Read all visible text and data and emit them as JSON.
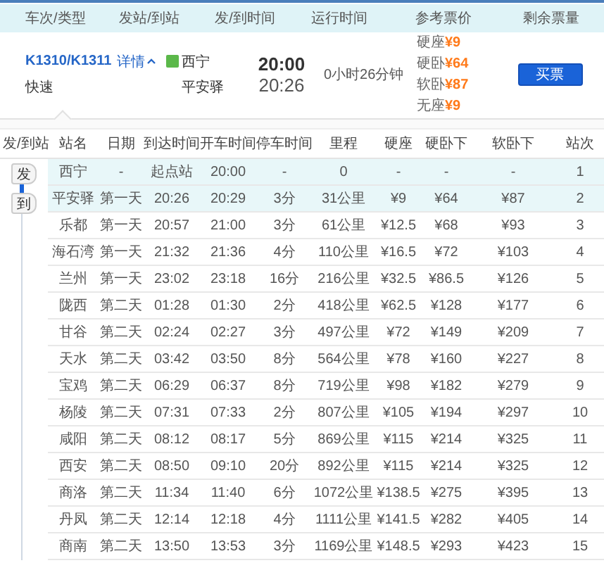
{
  "header": [
    "车次/类型",
    "发站/到站",
    "发/到时间",
    "运行时间",
    "参考票价",
    "剩余票量"
  ],
  "train": {
    "number": "K1310/K1311",
    "details_link": "详情",
    "expanded": true,
    "type": "快速",
    "from_station": "西宁",
    "to_station": "平安驿",
    "depart_time": "20:00",
    "arrive_time": "20:26",
    "duration": "0小时26分钟",
    "prices": [
      {
        "seat": "硬座",
        "price": "¥9"
      },
      {
        "seat": "硬卧",
        "price": "¥64"
      },
      {
        "seat": "软卧",
        "price": "¥87"
      },
      {
        "seat": "无座",
        "price": "¥9"
      }
    ],
    "buy_button": "买票"
  },
  "stops": {
    "columns": [
      "发/到站",
      "站名",
      "日期",
      "到达时间",
      "开车时间",
      "停车时间",
      "里程",
      "硬座",
      "硬卧下",
      "软卧下",
      "站次"
    ],
    "from_marker": "发",
    "to_marker": "到",
    "rows": [
      {
        "name": "西宁",
        "date": "-",
        "arrive": "起点站",
        "depart": "20:00",
        "stop": "-",
        "distance": "0",
        "hard_seat": "-",
        "hard_sleeper": "-",
        "soft_sleeper": "-",
        "index": "1",
        "selected": true
      },
      {
        "name": "平安驿",
        "date": "第一天",
        "arrive": "20:26",
        "depart": "20:29",
        "stop": "3分",
        "distance": "31公里",
        "hard_seat": "¥9",
        "hard_sleeper": "¥64",
        "soft_sleeper": "¥87",
        "index": "2",
        "selected": true
      },
      {
        "name": "乐都",
        "date": "第一天",
        "arrive": "20:57",
        "depart": "21:00",
        "stop": "3分",
        "distance": "61公里",
        "hard_seat": "¥12.5",
        "hard_sleeper": "¥68",
        "soft_sleeper": "¥93",
        "index": "3",
        "selected": false
      },
      {
        "name": "海石湾",
        "date": "第一天",
        "arrive": "21:32",
        "depart": "21:36",
        "stop": "4分",
        "distance": "110公里",
        "hard_seat": "¥16.5",
        "hard_sleeper": "¥72",
        "soft_sleeper": "¥103",
        "index": "4",
        "selected": false
      },
      {
        "name": "兰州",
        "date": "第一天",
        "arrive": "23:02",
        "depart": "23:18",
        "stop": "16分",
        "distance": "216公里",
        "hard_seat": "¥32.5",
        "hard_sleeper": "¥86.5",
        "soft_sleeper": "¥126",
        "index": "5",
        "selected": false
      },
      {
        "name": "陇西",
        "date": "第二天",
        "arrive": "01:28",
        "depart": "01:30",
        "stop": "2分",
        "distance": "418公里",
        "hard_seat": "¥62.5",
        "hard_sleeper": "¥128",
        "soft_sleeper": "¥177",
        "index": "6",
        "selected": false
      },
      {
        "name": "甘谷",
        "date": "第二天",
        "arrive": "02:24",
        "depart": "02:27",
        "stop": "3分",
        "distance": "497公里",
        "hard_seat": "¥72",
        "hard_sleeper": "¥149",
        "soft_sleeper": "¥209",
        "index": "7",
        "selected": false
      },
      {
        "name": "天水",
        "date": "第二天",
        "arrive": "03:42",
        "depart": "03:50",
        "stop": "8分",
        "distance": "564公里",
        "hard_seat": "¥78",
        "hard_sleeper": "¥160",
        "soft_sleeper": "¥227",
        "index": "8",
        "selected": false
      },
      {
        "name": "宝鸡",
        "date": "第二天",
        "arrive": "06:29",
        "depart": "06:37",
        "stop": "8分",
        "distance": "719公里",
        "hard_seat": "¥98",
        "hard_sleeper": "¥182",
        "soft_sleeper": "¥279",
        "index": "9",
        "selected": false
      },
      {
        "name": "杨陵",
        "date": "第二天",
        "arrive": "07:31",
        "depart": "07:33",
        "stop": "2分",
        "distance": "807公里",
        "hard_seat": "¥105",
        "hard_sleeper": "¥194",
        "soft_sleeper": "¥297",
        "index": "10",
        "selected": false
      },
      {
        "name": "咸阳",
        "date": "第二天",
        "arrive": "08:12",
        "depart": "08:17",
        "stop": "5分",
        "distance": "869公里",
        "hard_seat": "¥115",
        "hard_sleeper": "¥214",
        "soft_sleeper": "¥325",
        "index": "11",
        "selected": false
      },
      {
        "name": "西安",
        "date": "第二天",
        "arrive": "08:50",
        "depart": "09:10",
        "stop": "20分",
        "distance": "892公里",
        "hard_seat": "¥115",
        "hard_sleeper": "¥214",
        "soft_sleeper": "¥325",
        "index": "12",
        "selected": false
      },
      {
        "name": "商洛",
        "date": "第二天",
        "arrive": "11:34",
        "depart": "11:40",
        "stop": "6分",
        "distance": "1072公里",
        "hard_seat": "¥138.5",
        "hard_sleeper": "¥275",
        "soft_sleeper": "¥395",
        "index": "13",
        "selected": false
      },
      {
        "name": "丹凤",
        "date": "第二天",
        "arrive": "12:14",
        "depart": "12:18",
        "stop": "4分",
        "distance": "1111公里",
        "hard_seat": "¥141.5",
        "hard_sleeper": "¥282",
        "soft_sleeper": "¥405",
        "index": "14",
        "selected": false
      },
      {
        "name": "商南",
        "date": "第二天",
        "arrive": "13:50",
        "depart": "13:53",
        "stop": "3分",
        "distance": "1169公里",
        "hard_seat": "¥148.5",
        "hard_sleeper": "¥293",
        "soft_sleeper": "¥423",
        "index": "15",
        "selected": false
      }
    ]
  }
}
